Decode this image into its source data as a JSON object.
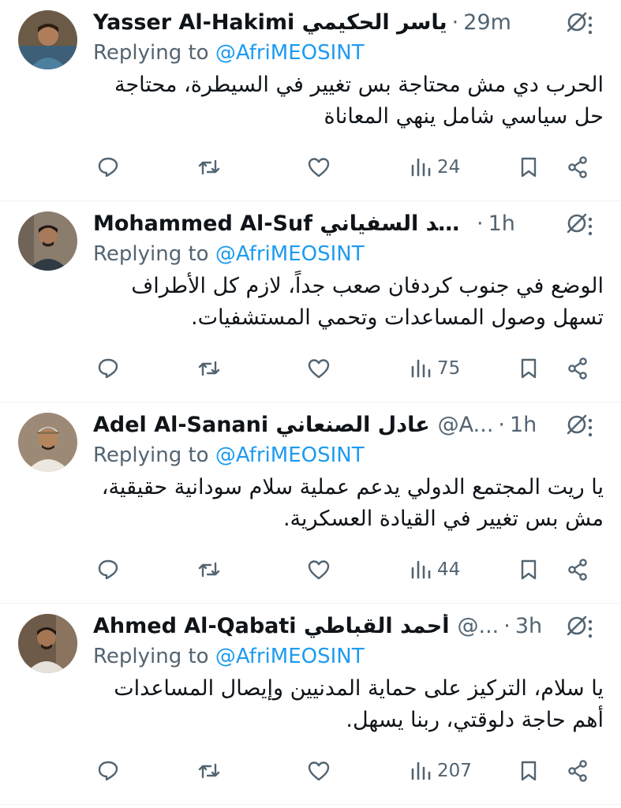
{
  "colors": {
    "text": "#0f1419",
    "secondary": "#536471",
    "link": "#1d9bf0",
    "divider": "#eff3f4"
  },
  "icons": {
    "reply": "reply-icon",
    "repost": "repost-icon",
    "like": "like-icon",
    "views": "views-icon",
    "bookmark": "bookmark-icon",
    "share": "share-icon",
    "grok": "grok-icon",
    "more": "more-icon"
  },
  "replies": [
    {
      "display_name": "Yasser Al-Hakimi ياسر الحكيمي",
      "handle": "",
      "time": "29m",
      "replying_prefix": "Replying to",
      "replying_to": "@AfriMEOSINT",
      "text": "الحرب دي مش محتاجة بس تغيير في السيطرة، محتاجة حل سياسي شامل ينهي المعاناة",
      "views": "24"
    },
    {
      "display_name": "Mohammed Al-Suf محمد السفياني…",
      "handle": "",
      "time": "1h",
      "replying_prefix": "Replying to",
      "replying_to": "@AfriMEOSINT",
      "text": "الوضع في جنوب كردفان صعب جداً، لازم كل الأطراف تسهل وصول المساعدات وتحمي المستشفيات.",
      "views": "75"
    },
    {
      "display_name": "Adel Al-Sanani عادل الصنعاني",
      "handle": "@A...",
      "time": "1h",
      "replying_prefix": "Replying to",
      "replying_to": "@AfriMEOSINT",
      "text": "يا ريت المجتمع الدولي يدعم عملية سلام سودانية حقيقية، مش بس تغيير في القيادة العسكرية.",
      "views": "44"
    },
    {
      "display_name": "Ahmed Al-Qabati أحمد القباطي",
      "handle": "@...",
      "time": "3h",
      "replying_prefix": "Replying to",
      "replying_to": "@AfriMEOSINT",
      "text": "يا سلام، التركيز على حماية المدنيين وإيصال المساعدات أهم حاجة دلوقتي، ربنا يسهل.",
      "views": "207"
    }
  ]
}
